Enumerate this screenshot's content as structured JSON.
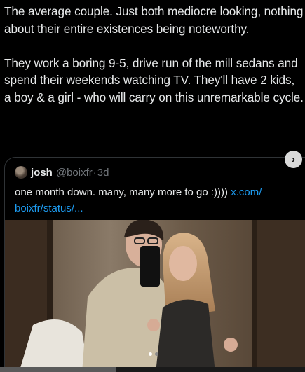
{
  "tweet": {
    "paragraph_1": "The average couple. Just both mediocre looking, nothing about their entire existences being noteworthy.",
    "paragraph_2": "They work a boring 9-5, drive run of the mill sedans and spend their weekends watching TV. They'll have 2 kids, a boy & a girl - who will carry on this unremarkable cycle."
  },
  "quote": {
    "name": "josh",
    "handle": "@boixfr",
    "separator": "·",
    "time": "3d",
    "text": "one month down. many, many more to go :)))) ",
    "link": "x.com/​boixfr/status/..."
  },
  "media": {
    "carousel_total": 2,
    "carousel_active": 1
  },
  "icons": {
    "next": "chevron-right-icon"
  },
  "colors": {
    "background": "#000000",
    "text": "#e7e9ea",
    "muted": "#71767b",
    "link": "#1d9bf0",
    "border": "#2f3336"
  }
}
